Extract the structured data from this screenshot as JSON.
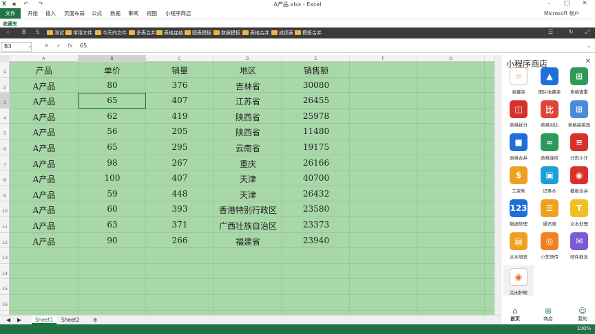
{
  "window": {
    "title": "A产品.xlsx - Excel",
    "account": "Microsoft 帐户",
    "icon": "excel-icon"
  },
  "quick_access": [
    "save-icon",
    "undo-icon",
    "redo-icon"
  ],
  "ribbon_tabs": [
    "文件",
    "开始",
    "插入",
    "页面布局",
    "公式",
    "数据",
    "审阅",
    "视图",
    "小程序商店"
  ],
  "fav_label": "收藏夹",
  "bookmarks": [
    "测试",
    "常用文件",
    "今天的文件",
    "多表合并",
    "表格连结",
    "图表模板",
    "数据模板",
    "表格合并",
    "成绩表",
    "模板合并"
  ],
  "bookmark_left": [
    "‹",
    "B",
    "S"
  ],
  "formula_bar": {
    "name_box": "B3",
    "value": "65",
    "fx_label": "fx"
  },
  "columns": [
    "A",
    "B",
    "C",
    "D",
    "E",
    "F",
    "G"
  ],
  "rows": [
    "1",
    "2",
    "3",
    "4",
    "5",
    "6",
    "7",
    "8",
    "9",
    "10",
    "11",
    "12",
    "13",
    "14",
    "15",
    "16"
  ],
  "table": {
    "headers": [
      "产品",
      "单价",
      "销量",
      "地区",
      "销售额"
    ],
    "data": [
      [
        "A产品",
        "80",
        "376",
        "吉林省",
        "30080"
      ],
      [
        "A产品",
        "65",
        "407",
        "江苏省",
        "26455"
      ],
      [
        "A产品",
        "62",
        "419",
        "陕西省",
        "25978"
      ],
      [
        "A产品",
        "56",
        "205",
        "陕西省",
        "11480"
      ],
      [
        "A产品",
        "65",
        "295",
        "云南省",
        "19175"
      ],
      [
        "A产品",
        "98",
        "267",
        "重庆",
        "26166"
      ],
      [
        "A产品",
        "100",
        "407",
        "天津",
        "40700"
      ],
      [
        "A产品",
        "59",
        "448",
        "天津",
        "26432"
      ],
      [
        "A产品",
        "60",
        "393",
        "香港特别行政区",
        "23580"
      ],
      [
        "A产品",
        "63",
        "371",
        "广西壮族自治区",
        "23373"
      ],
      [
        "A产品",
        "90",
        "266",
        "福建省",
        "23940"
      ]
    ]
  },
  "sheets": [
    "Sheet1",
    "Sheet2"
  ],
  "zoom": "100%",
  "panel": {
    "title": "小程序商店",
    "items": [
      {
        "label": "收藏夹",
        "icon": "star-icon",
        "glyph": "☆",
        "color": "#ffffff"
      },
      {
        "label": "图片收藏夹",
        "icon": "image-icon",
        "glyph": "▲",
        "color": "#1e6fd9"
      },
      {
        "label": "表格查重",
        "icon": "table-search-icon",
        "glyph": "⊞",
        "color": "#2e9a5a"
      },
      {
        "label": "表格拆分",
        "icon": "split-icon",
        "glyph": "◫",
        "color": "#d8312a"
      },
      {
        "label": "表格对比",
        "icon": "compare-icon",
        "glyph": "比",
        "color": "#e0443a"
      },
      {
        "label": "表格高级选",
        "icon": "grid-icon",
        "glyph": "⊞",
        "color": "#4a8ad6"
      },
      {
        "label": "表格合并",
        "icon": "merge-icon",
        "glyph": "■",
        "color": "#1e6fd9"
      },
      {
        "label": "表格连结",
        "icon": "link-icon",
        "glyph": "∞",
        "color": "#2e9a5a"
      },
      {
        "label": "分页小计",
        "icon": "page-icon",
        "glyph": "≡",
        "color": "#d8312a"
      },
      {
        "label": "工资条",
        "icon": "salary-icon",
        "glyph": "$",
        "color": "#f0a020"
      },
      {
        "label": "记事本",
        "icon": "notebook-icon",
        "glyph": "▣",
        "color": "#1aa0d8"
      },
      {
        "label": "模板合并",
        "icon": "template-icon",
        "glyph": "◉",
        "color": "#d8312a"
      },
      {
        "label": "数据处理",
        "icon": "data-icon",
        "glyph": "123",
        "color": "#1e6fd9"
      },
      {
        "label": "通讯录",
        "icon": "contacts-icon",
        "glyph": "☰",
        "color": "#f0a020"
      },
      {
        "label": "文本处理",
        "icon": "text-icon",
        "glyph": "T",
        "color": "#f0c020"
      },
      {
        "label": "文本填充",
        "icon": "fill-icon",
        "glyph": "▤",
        "color": "#f0a020"
      },
      {
        "label": "小艺快传",
        "icon": "transfer-icon",
        "glyph": "◎",
        "color": "#f08020"
      },
      {
        "label": "邮件群发",
        "icon": "mail-icon",
        "glyph": "✉",
        "color": "#7a5ad6"
      },
      {
        "label": "关闭护眼",
        "icon": "eye-icon",
        "glyph": "◉",
        "color": "#ffffff"
      }
    ],
    "bottom_nav": [
      {
        "label": "首页",
        "icon": "home-icon",
        "glyph": "⌂"
      },
      {
        "label": "商店",
        "icon": "store-icon",
        "glyph": "⊞"
      },
      {
        "label": "我的",
        "icon": "user-icon",
        "glyph": "☺"
      }
    ]
  }
}
